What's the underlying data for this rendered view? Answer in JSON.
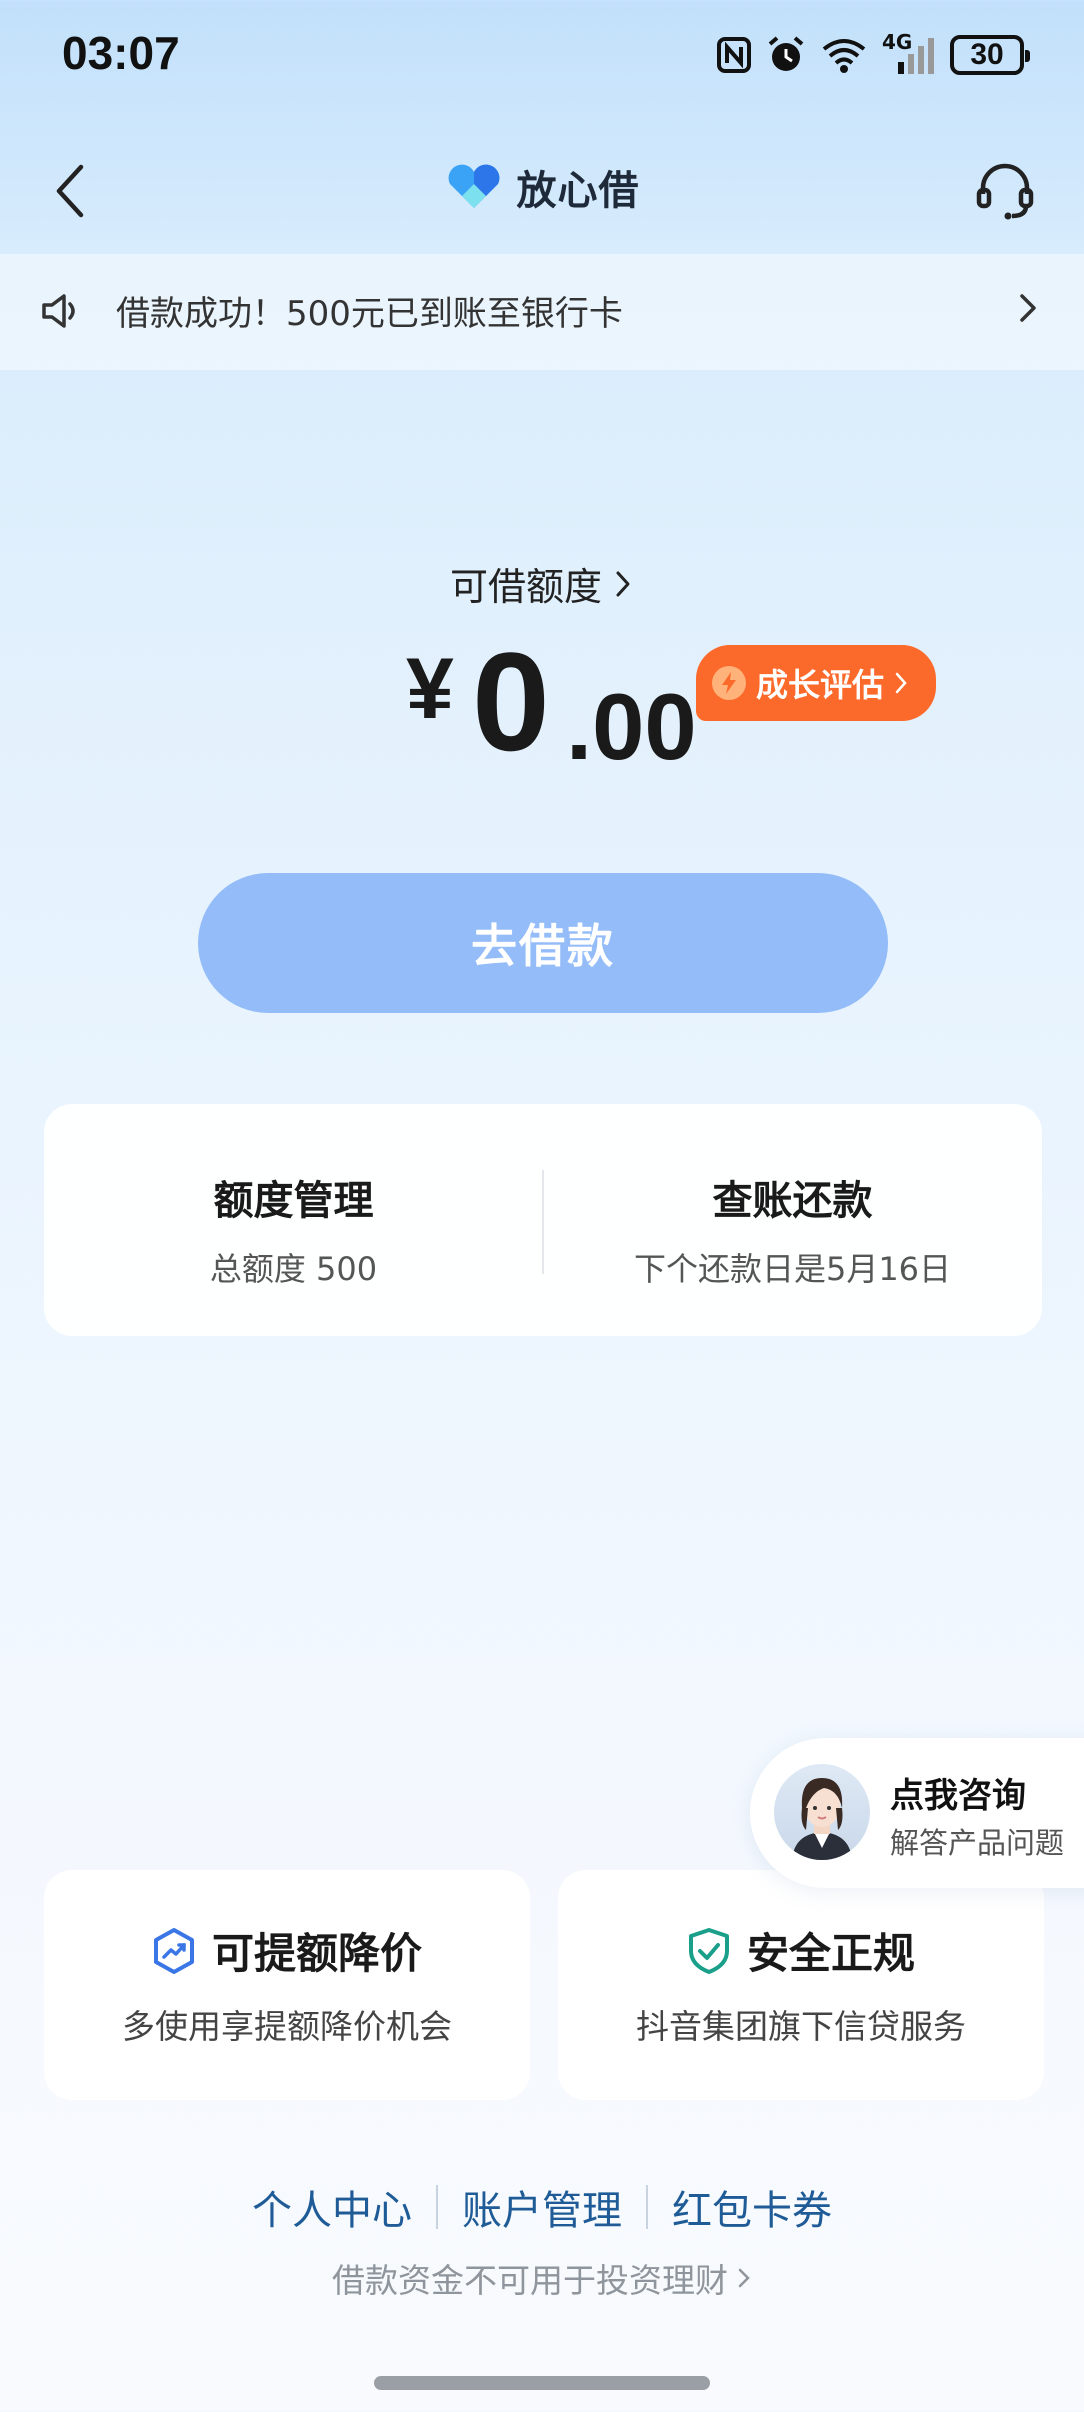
{
  "status_bar": {
    "time": "03:07",
    "network": "4G",
    "battery": "30",
    "icons": [
      "nfc-icon",
      "alarm-icon",
      "wifi-icon",
      "signal-icon",
      "battery-icon"
    ]
  },
  "nav": {
    "title": "放心借",
    "back_icon": "chevron-left-icon",
    "support_icon": "headset-icon"
  },
  "notice": {
    "text": "借款成功！500元已到账至银行卡"
  },
  "credit": {
    "label": "可借额度",
    "currency": "¥",
    "amount_int": "0",
    "amount_dec": ".00",
    "badge": "成长评估"
  },
  "borrow_button": "去借款",
  "quota_card": {
    "left_title": "额度管理",
    "left_sub": "总额度 500",
    "right_title": "查账还款",
    "right_sub": "下个还款日是5月16日"
  },
  "consult": {
    "title": "点我咨询",
    "subtitle": "解答产品问题"
  },
  "features": [
    {
      "title": "可提额降价",
      "subtitle": "多使用享提额降价机会",
      "icon": "trend-up-icon",
      "color": "#3a76e6"
    },
    {
      "title": "安全正规",
      "subtitle": "抖音集团旗下信贷服务",
      "icon": "shield-check-icon",
      "color": "#1aa08a"
    }
  ],
  "footer": {
    "links": [
      "个人中心",
      "账户管理",
      "红包卡券"
    ],
    "disclaimer": "借款资金不可用于投资理财"
  },
  "colors": {
    "accent_button": "#93bcf9",
    "badge": "#fc6a2b",
    "link": "#1f5c97"
  }
}
